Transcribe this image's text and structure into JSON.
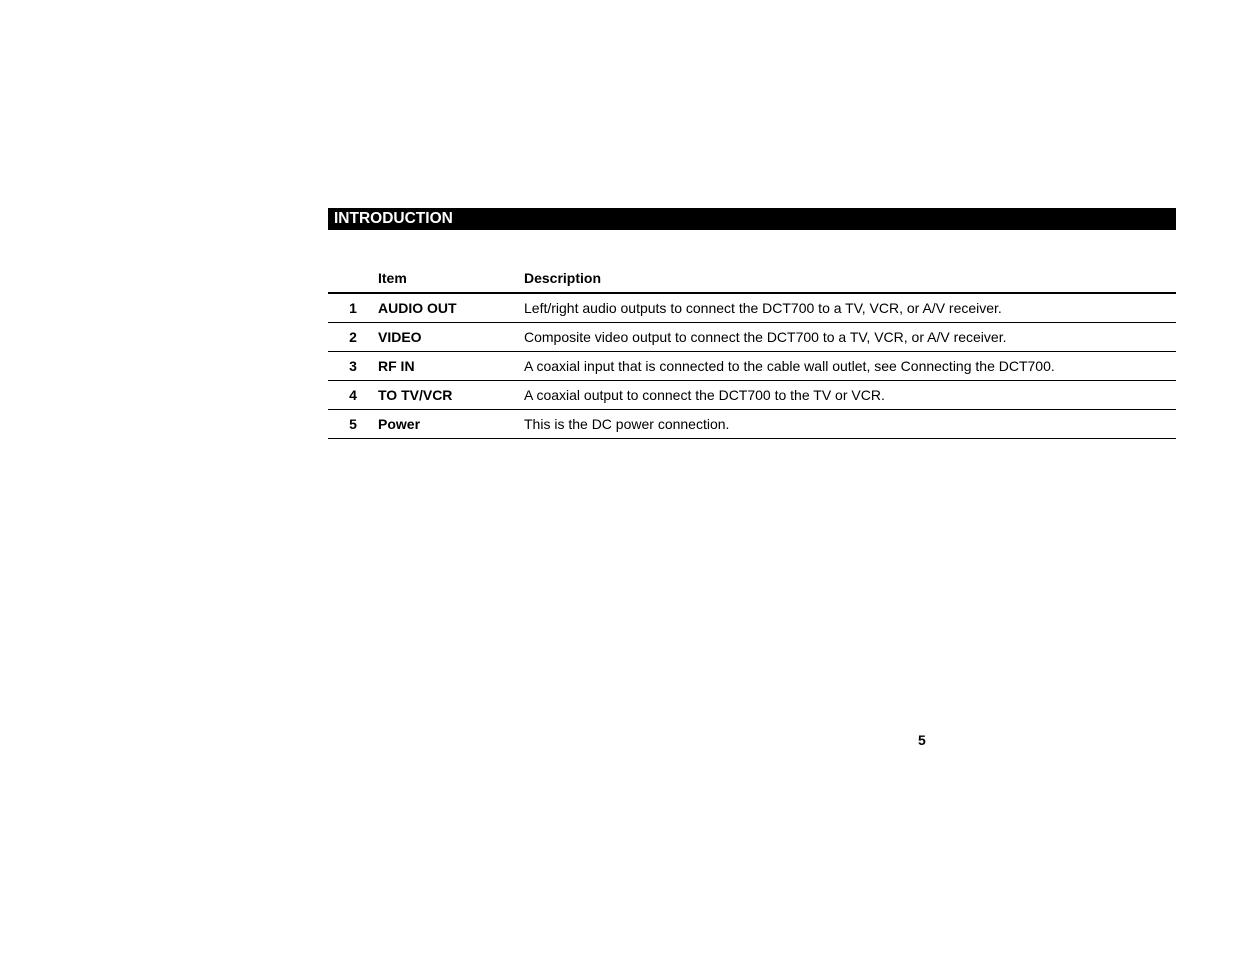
{
  "section_title": "INTRODUCTION",
  "table": {
    "headers": {
      "num": "",
      "item": "Item",
      "description": "Description"
    },
    "rows": [
      {
        "num": "1",
        "item": "AUDIO OUT",
        "description": "Left/right audio outputs to connect the DCT700 to a TV, VCR, or A/V receiver."
      },
      {
        "num": "2",
        "item": "VIDEO",
        "description": "Composite video output to connect the DCT700 to a TV, VCR, or A/V receiver."
      },
      {
        "num": "3",
        "item": "RF IN",
        "description": "A coaxial input that is connected to the cable wall outlet, see Connecting the DCT700."
      },
      {
        "num": "4",
        "item": "TO TV/VCR",
        "description": "A coaxial output to connect the DCT700 to the TV or VCR."
      },
      {
        "num": "5",
        "item": "Power",
        "description": "This is the DC power connection."
      }
    ]
  },
  "page_number": "5"
}
